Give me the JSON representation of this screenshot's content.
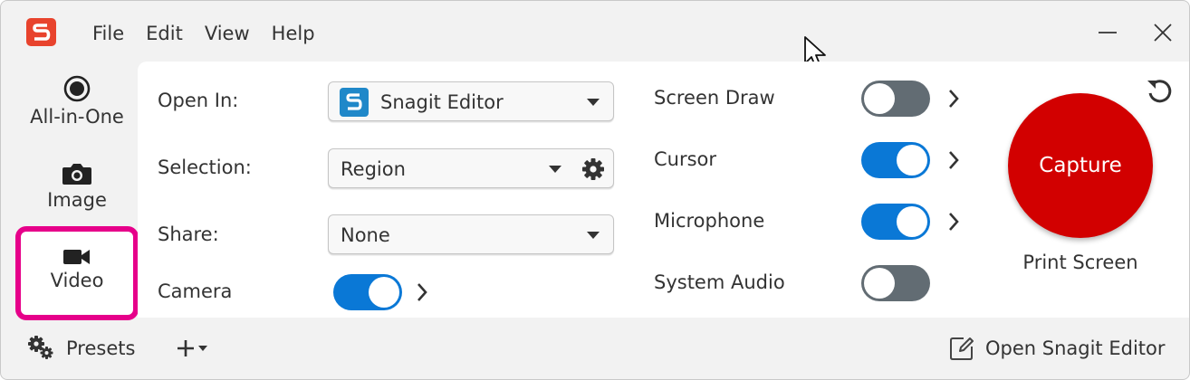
{
  "titlebar": {
    "menu": [
      "File",
      "Edit",
      "View",
      "Help"
    ]
  },
  "modes": {
    "all_in_one": "All-in-One",
    "image": "Image",
    "video": "Video",
    "selected_border_color": "#e6008a"
  },
  "settings": {
    "open_in": {
      "label": "Open In:",
      "value": "Snagit Editor"
    },
    "selection": {
      "label": "Selection:",
      "value": "Region"
    },
    "share": {
      "label": "Share:",
      "value": "None"
    },
    "camera": {
      "label": "Camera",
      "on": true
    }
  },
  "effects": {
    "screen_draw": {
      "label": "Screen Draw",
      "on": false
    },
    "cursor": {
      "label": "Cursor",
      "on": true
    },
    "microphone": {
      "label": "Microphone",
      "on": true
    },
    "system_audio": {
      "label": "System Audio",
      "on": false
    }
  },
  "capture": {
    "button_label": "Capture",
    "hotkey": "Print Screen",
    "color": "#d20000"
  },
  "bottom": {
    "presets": "Presets",
    "open_editor": "Open Snagit Editor"
  },
  "colors": {
    "toggle_on": "#0a78d6",
    "toggle_off": "#626c73",
    "logo": "#e8432d"
  },
  "icons": [
    "snagit-logo-icon",
    "minimize-icon",
    "close-icon",
    "all-in-one-icon",
    "camera-icon",
    "video-camera-icon",
    "gear-icon",
    "chevron-down-icon",
    "chevron-right-icon",
    "reset-icon",
    "add-preset-icon",
    "edit-icon"
  ]
}
